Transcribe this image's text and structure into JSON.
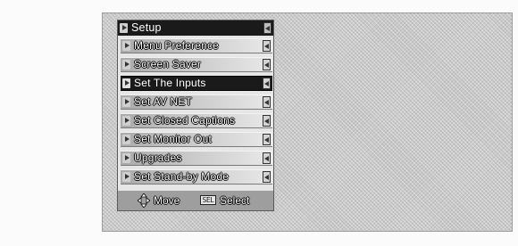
{
  "menu": {
    "title": "Setup",
    "items": [
      {
        "label": "Menu Preference",
        "selected": false
      },
      {
        "label": "Screen Saver",
        "selected": false
      },
      {
        "label": "Set The Inputs",
        "selected": true
      },
      {
        "label": "Set AV NET",
        "selected": false
      },
      {
        "label": "Set Closed Captions",
        "selected": false
      },
      {
        "label": "Set Monitor Out",
        "selected": false
      },
      {
        "label": "Upgrades",
        "selected": false
      },
      {
        "label": "Set Stand-by Mode",
        "selected": false
      }
    ]
  },
  "legend": {
    "move_label": "Move",
    "sel_key": "SEL",
    "select_label": "Select"
  },
  "icons": {
    "move": "dpad-arrows-icon",
    "sel": "sel-key-icon"
  }
}
